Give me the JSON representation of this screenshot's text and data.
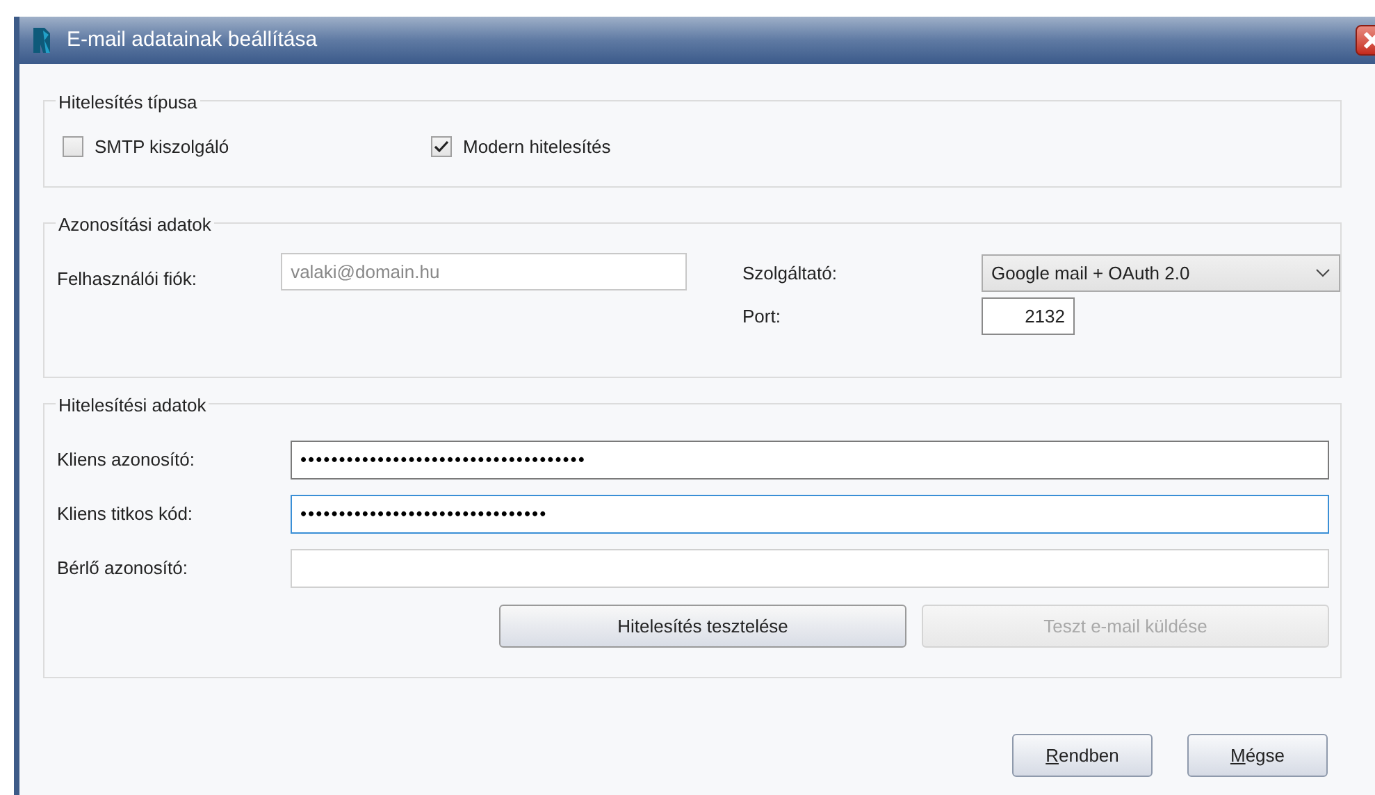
{
  "window": {
    "title": "E-mail adatainak beállítása"
  },
  "auth_type": {
    "legend": "Hitelesítés típusa",
    "options": [
      {
        "label": "SMTP kiszolgáló",
        "checked": false
      },
      {
        "label": "Modern hitelesítés",
        "checked": true
      }
    ]
  },
  "identity": {
    "legend": "Azonosítási adatok",
    "account_label": "Felhasználói fiók:",
    "account_placeholder": "valaki@domain.hu",
    "provider_label": "Szolgáltató:",
    "provider_value": "Google mail + OAuth 2.0",
    "port_label": "Port:",
    "port_value": "2132"
  },
  "credentials": {
    "legend": "Hitelesítési adatok",
    "fields": [
      {
        "label": "Kliens azonosító:",
        "value": "•••••••••••••••••••••••••••••••••••••",
        "focused": false
      },
      {
        "label": "Kliens titkos kód:",
        "value": "••••••••••••••••••••••••••••••••",
        "focused": true
      },
      {
        "label": "Bérlő azonosító:",
        "focused": false
      }
    ],
    "buttons": [
      {
        "label": "Hitelesítés tesztelése",
        "disabled": false
      },
      {
        "label": "Teszt e-mail küldése",
        "disabled": true
      }
    ]
  },
  "footer_buttons": [
    {
      "label": "Rendben",
      "underline_first": true
    },
    {
      "label": "Mégse",
      "underline_first": true
    }
  ]
}
